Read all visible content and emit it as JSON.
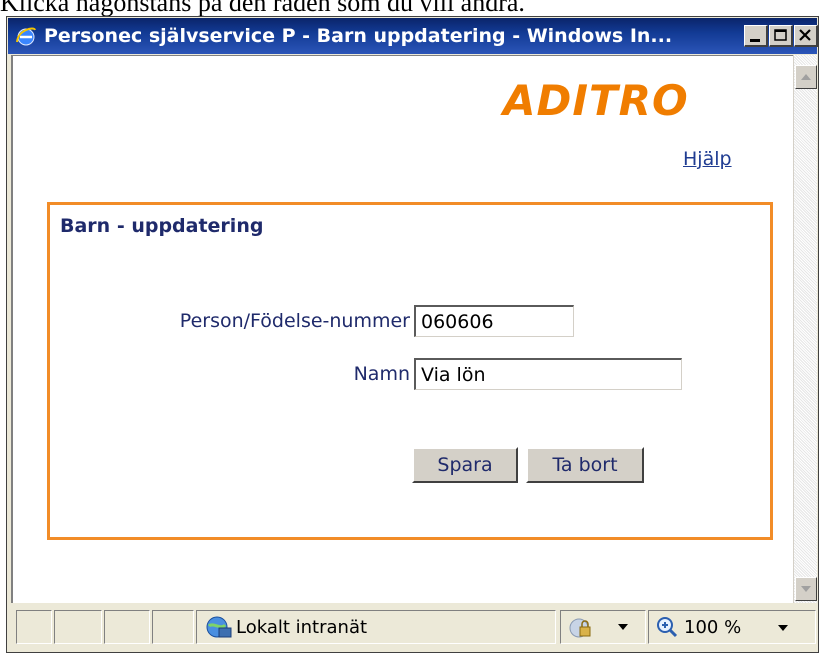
{
  "caption": "Klicka någonstans på den raden som du vill ändra.",
  "window": {
    "title": "Personec självservice P - Barn uppdatering - Windows In...",
    "buttons": {
      "minimize": "minimize",
      "maximize": "maximize",
      "close": "close"
    }
  },
  "page": {
    "logo": "ADITRO",
    "help_link": "Hjälp",
    "panel_title": "Barn - uppdatering",
    "fields": {
      "pnr_label": "Person/Födelse-nummer",
      "pnr_value": "060606",
      "name_label": "Namn",
      "name_value": "Via lön"
    },
    "buttons": {
      "save": "Spara",
      "delete": "Ta bort"
    }
  },
  "statusbar": {
    "zone": "Lokalt intranät",
    "zoom": "100 %"
  },
  "colors": {
    "accent": "#f07d00",
    "panel_border": "#f28c28",
    "label_text": "#1f2a6b",
    "titlebar": "#0a246a"
  },
  "icons": [
    "ie-icon",
    "minimize-icon",
    "maximize-icon",
    "close-icon",
    "scroll-up-icon",
    "scroll-down-icon",
    "intranet-icon",
    "security-icon",
    "zoom-icon",
    "dropdown-icon"
  ]
}
